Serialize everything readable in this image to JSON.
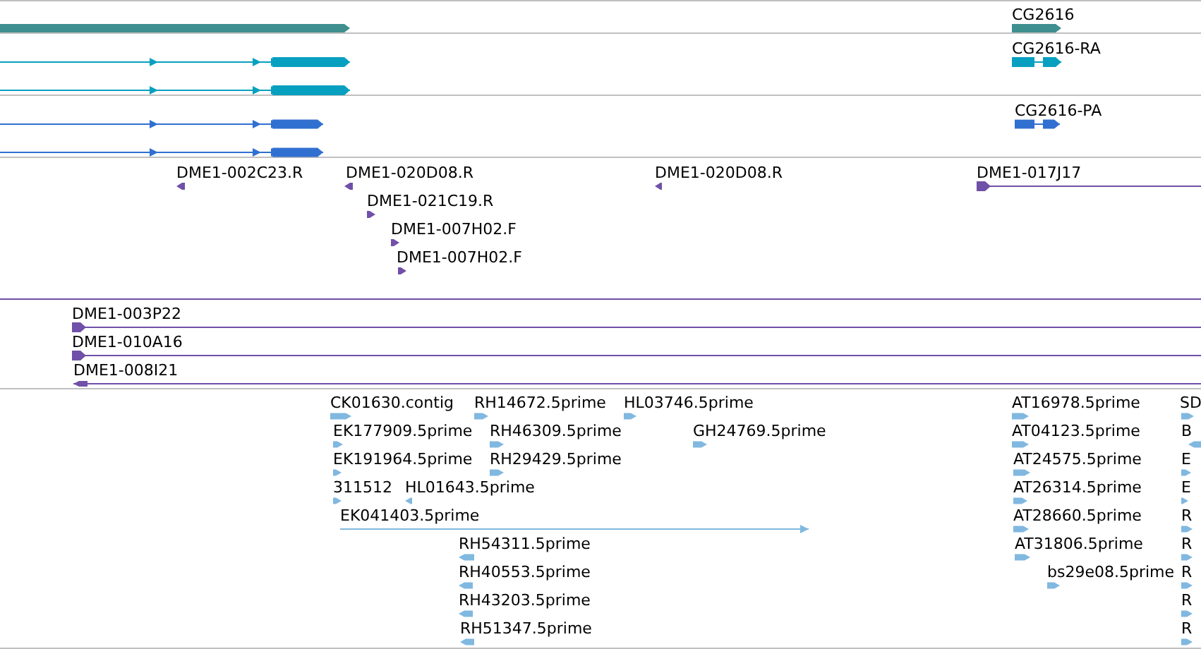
{
  "tracks": [
    {
      "kind": "gene",
      "color": "#3f8f8f",
      "features": [
        {
          "kind": "block",
          "reverse": false
        },
        {
          "kind": "block",
          "reverse": false,
          "label": "CG2616"
        }
      ]
    },
    {
      "kind": "transcript",
      "color": "#08a0c0",
      "features": [
        {
          "kind": "spliced",
          "reverse": false
        },
        {
          "kind": "spliced",
          "reverse": false
        },
        {
          "kind": "spliced",
          "reverse": false,
          "label": "CG2616-RA"
        }
      ]
    },
    {
      "kind": "protein",
      "color": "#3070d0",
      "features": [
        {
          "kind": "spliced",
          "reverse": false
        },
        {
          "kind": "spliced",
          "reverse": false
        },
        {
          "kind": "spliced",
          "reverse": false,
          "label": "CG2616-PA"
        }
      ]
    },
    {
      "kind": "clone",
      "color": "#7050a8",
      "features": [
        {
          "kind": "read",
          "reverse": true,
          "label": "DME1-002C23.R"
        },
        {
          "kind": "read",
          "reverse": true,
          "label": "DME1-020D08.R"
        },
        {
          "kind": "read",
          "reverse": true,
          "label": "DME1-020D08.R"
        },
        {
          "kind": "span",
          "reverse": false,
          "label": "DME1-017J17"
        },
        {
          "kind": "read",
          "reverse": false,
          "label": "DME1-021C19.R"
        },
        {
          "kind": "read",
          "reverse": false,
          "label": "DME1-007H02.F"
        },
        {
          "kind": "read",
          "reverse": false,
          "label": "DME1-007H02.F"
        },
        {
          "kind": "span"
        },
        {
          "kind": "span",
          "reverse": false,
          "label": "DME1-003P22"
        },
        {
          "kind": "span",
          "reverse": false,
          "label": "DME1-010A16"
        },
        {
          "kind": "span",
          "reverse": true,
          "label": "DME1-008I21"
        }
      ]
    },
    {
      "kind": "est",
      "color": "#80b8e0",
      "features": [
        {
          "kind": "read",
          "reverse": false,
          "label": "CK01630.contig"
        },
        {
          "kind": "read",
          "reverse": false,
          "label": "RH14672.5prime"
        },
        {
          "kind": "read",
          "reverse": false,
          "label": "HL03746.5prime"
        },
        {
          "kind": "read",
          "reverse": false,
          "label": "AT16978.5prime"
        },
        {
          "kind": "read",
          "reverse": false,
          "label": "SD"
        },
        {
          "kind": "read",
          "reverse": false,
          "label": "EK177909.5prime"
        },
        {
          "kind": "read",
          "reverse": false,
          "label": "RH46309.5prime"
        },
        {
          "kind": "read",
          "reverse": false,
          "label": "GH24769.5prime"
        },
        {
          "kind": "read",
          "reverse": false,
          "label": "AT04123.5prime"
        },
        {
          "kind": "read",
          "reverse": true,
          "label": "B"
        },
        {
          "kind": "read",
          "reverse": false,
          "label": "EK191964.5prime"
        },
        {
          "kind": "read",
          "reverse": false,
          "label": "RH29429.5prime"
        },
        {
          "kind": "read",
          "reverse": false,
          "label": "AT24575.5prime"
        },
        {
          "kind": "read",
          "reverse": false,
          "label": "E"
        },
        {
          "kind": "read",
          "reverse": false,
          "label": "311512"
        },
        {
          "kind": "read",
          "reverse": true,
          "label": "HL01643.5prime"
        },
        {
          "kind": "read",
          "reverse": false,
          "label": "AT26314.5prime"
        },
        {
          "kind": "read",
          "reverse": false,
          "label": "E"
        },
        {
          "kind": "span",
          "reverse": false,
          "label": "EK041403.5prime"
        },
        {
          "kind": "read",
          "reverse": false,
          "label": "AT28660.5prime"
        },
        {
          "kind": "read",
          "reverse": false,
          "label": "R"
        },
        {
          "kind": "read",
          "reverse": true,
          "label": "RH54311.5prime"
        },
        {
          "kind": "read",
          "reverse": false,
          "label": "AT31806.5prime"
        },
        {
          "kind": "read",
          "reverse": false,
          "label": "R"
        },
        {
          "kind": "read",
          "reverse": true,
          "label": "RH40553.5prime"
        },
        {
          "kind": "read",
          "reverse": false,
          "label": "bs29e08.5prime"
        },
        {
          "kind": "read",
          "reverse": false,
          "label": "R"
        },
        {
          "kind": "read",
          "reverse": true,
          "label": "RH43203.5prime"
        },
        {
          "kind": "read",
          "reverse": false,
          "label": "R"
        },
        {
          "kind": "read",
          "reverse": true,
          "label": "RH51347.5prime"
        },
        {
          "kind": "read",
          "reverse": false,
          "label": "R"
        }
      ]
    }
  ]
}
